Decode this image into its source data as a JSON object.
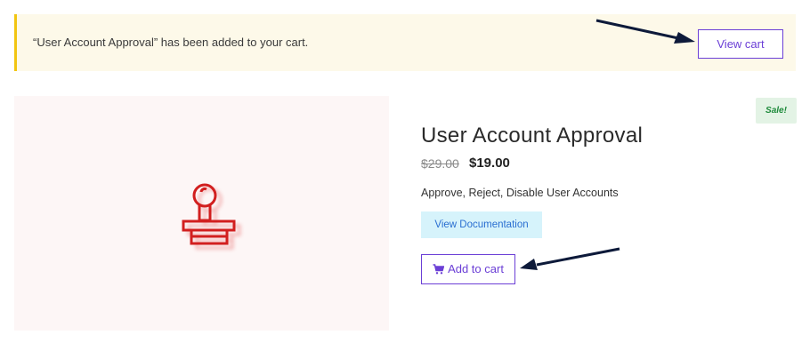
{
  "notice": {
    "message": "“User Account Approval” has been added to your cart.",
    "view_cart_label": "View cart"
  },
  "product": {
    "badge": "Sale!",
    "title": "User Account Approval",
    "price_old": "$29.00",
    "price_new": "$19.00",
    "short_description": "Approve, Reject, Disable User Accounts",
    "doc_button_label": "View Documentation",
    "add_to_cart_label": "Add to cart",
    "image_icon": "stamp-icon"
  },
  "colors": {
    "accent": "#6b3fd6",
    "notice_bg": "#fdf9e9",
    "notice_border": "#f2c511",
    "sale_bg": "#e3f3e5",
    "sale_text": "#1d8a3a",
    "doc_bg": "#d6f3fb",
    "stamp": "#d21f1f",
    "arrow": "#0d1a3a"
  }
}
